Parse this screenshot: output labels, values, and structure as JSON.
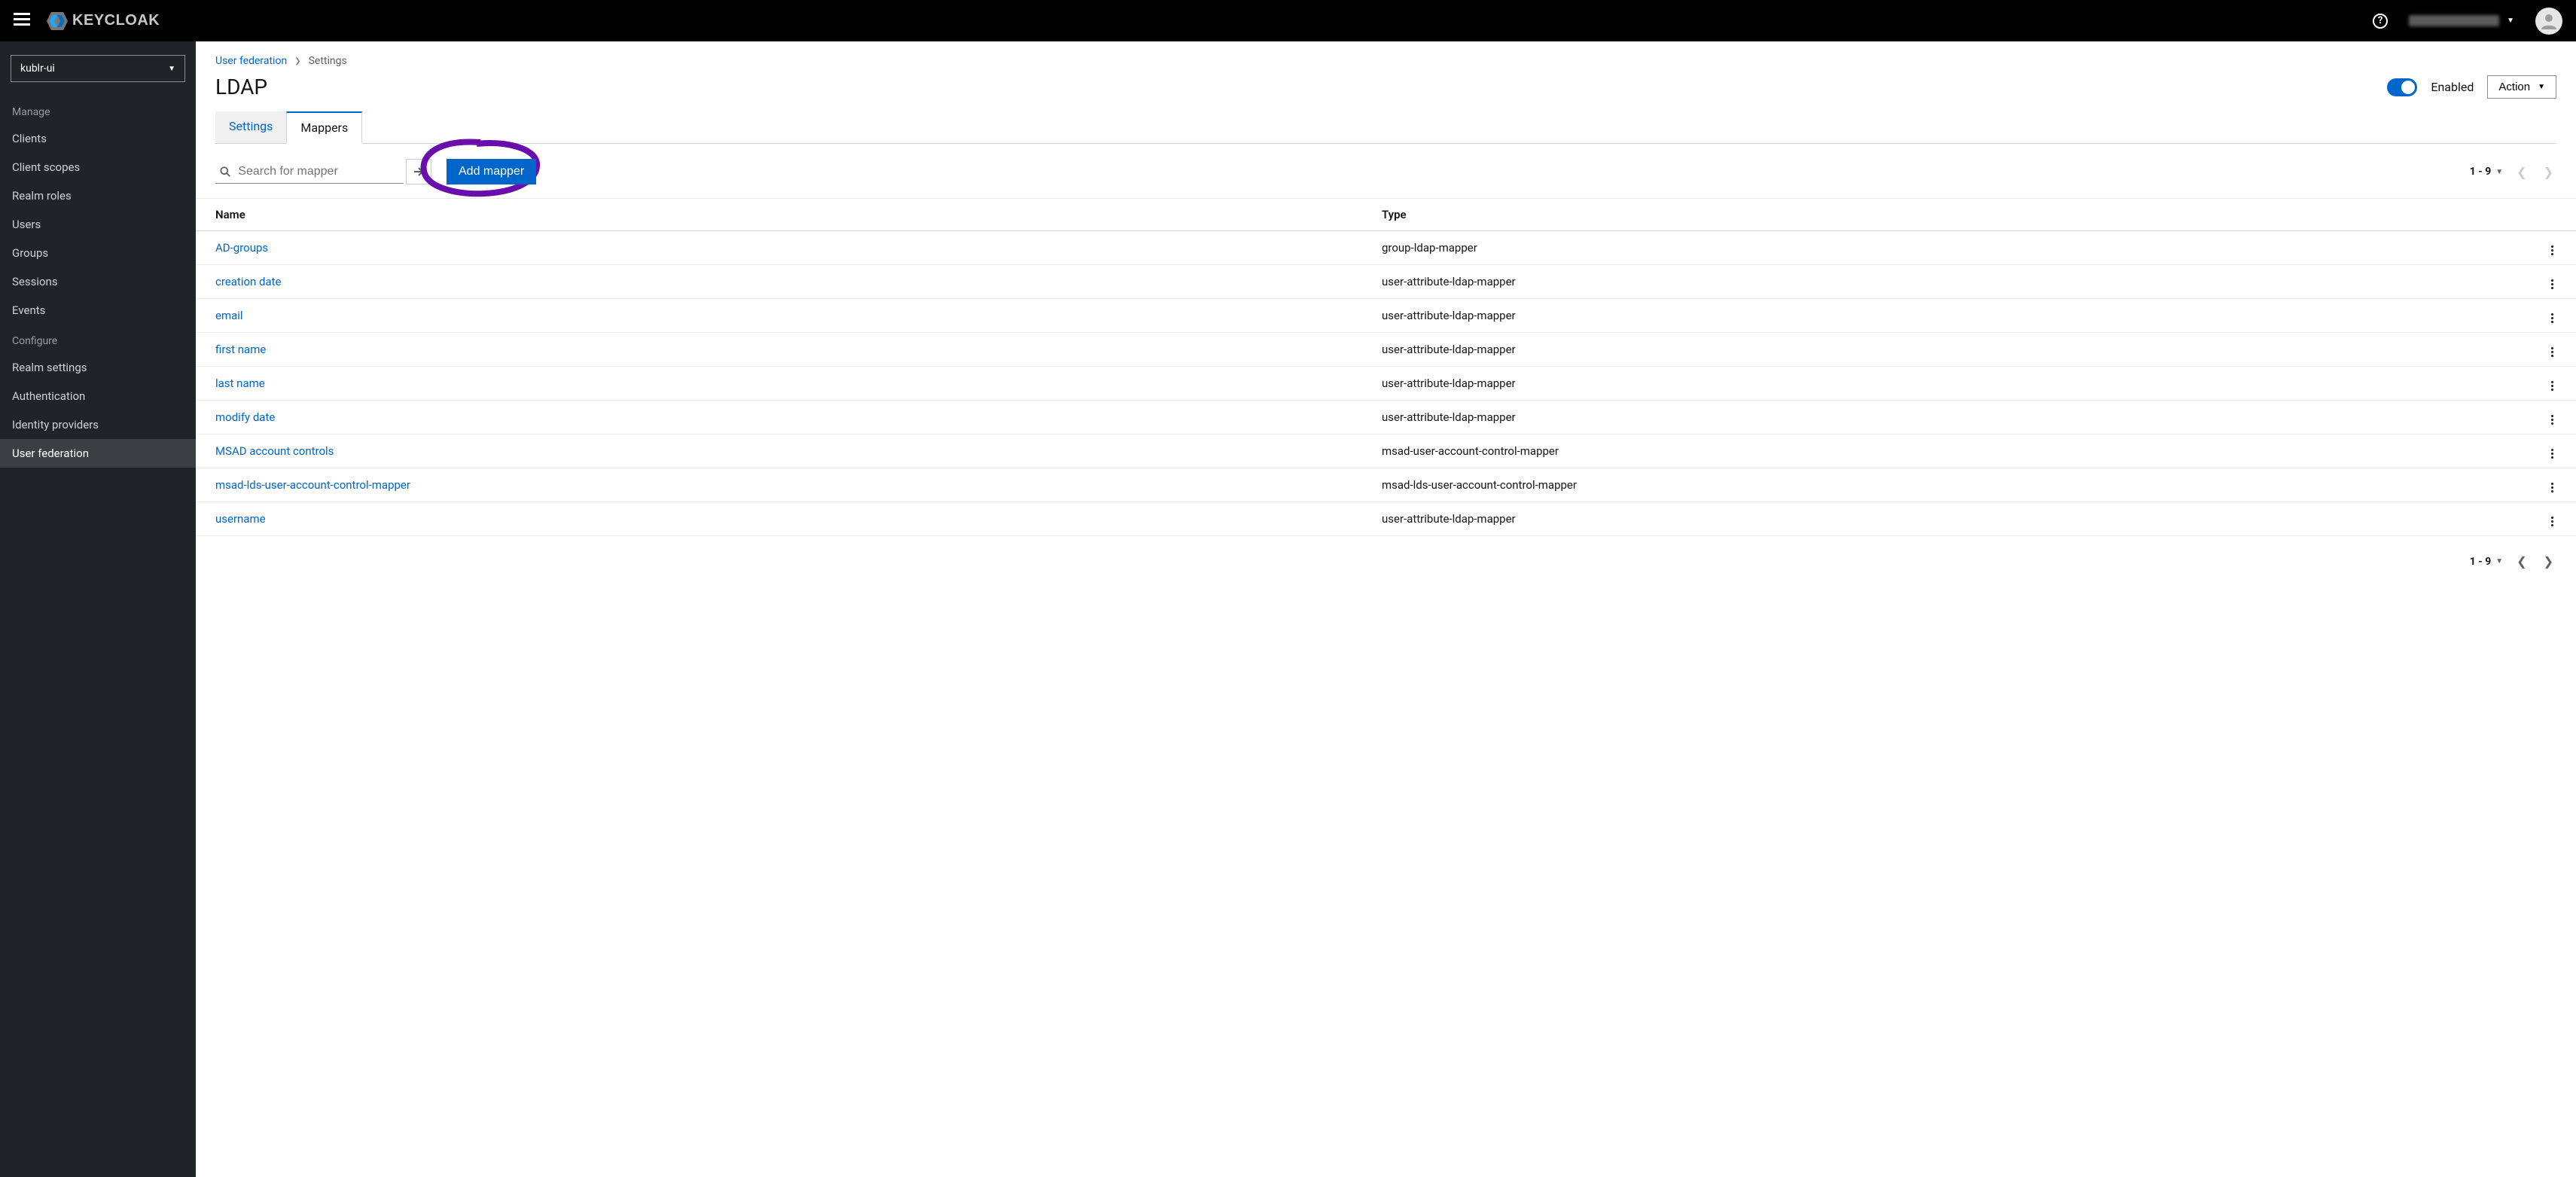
{
  "brand": {
    "name": "KEYCLOAK"
  },
  "topbar": {
    "help_tooltip": "?",
    "username_hidden": true
  },
  "realm_selector": {
    "value": "kublr-ui"
  },
  "sidebar": {
    "sections": [
      {
        "title": "Manage",
        "items": [
          {
            "label": "Clients"
          },
          {
            "label": "Client scopes"
          },
          {
            "label": "Realm roles"
          },
          {
            "label": "Users"
          },
          {
            "label": "Groups"
          },
          {
            "label": "Sessions"
          },
          {
            "label": "Events"
          }
        ]
      },
      {
        "title": "Configure",
        "items": [
          {
            "label": "Realm settings"
          },
          {
            "label": "Authentication"
          },
          {
            "label": "Identity providers"
          },
          {
            "label": "User federation",
            "active": true
          }
        ]
      }
    ]
  },
  "breadcrumb": {
    "link": "User federation",
    "current": "Settings"
  },
  "page": {
    "title": "LDAP",
    "enabled_label": "Enabled",
    "action_label": "Action"
  },
  "tabs": [
    {
      "label": "Settings",
      "active": false
    },
    {
      "label": "Mappers",
      "active": true
    }
  ],
  "toolbar": {
    "search_placeholder": "Search for mapper",
    "add_button": "Add mapper",
    "pagination": "1 - 9"
  },
  "table": {
    "columns": {
      "name": "Name",
      "type": "Type"
    },
    "rows": [
      {
        "name": "AD-groups",
        "type": "group-ldap-mapper"
      },
      {
        "name": "creation date",
        "type": "user-attribute-ldap-mapper"
      },
      {
        "name": "email",
        "type": "user-attribute-ldap-mapper"
      },
      {
        "name": "first name",
        "type": "user-attribute-ldap-mapper"
      },
      {
        "name": "last name",
        "type": "user-attribute-ldap-mapper"
      },
      {
        "name": "modify date",
        "type": "user-attribute-ldap-mapper"
      },
      {
        "name": "MSAD account controls",
        "type": "msad-user-account-control-mapper"
      },
      {
        "name": "msad-lds-user-account-control-mapper",
        "type": "msad-lds-user-account-control-mapper"
      },
      {
        "name": "username",
        "type": "user-attribute-ldap-mapper"
      }
    ]
  }
}
